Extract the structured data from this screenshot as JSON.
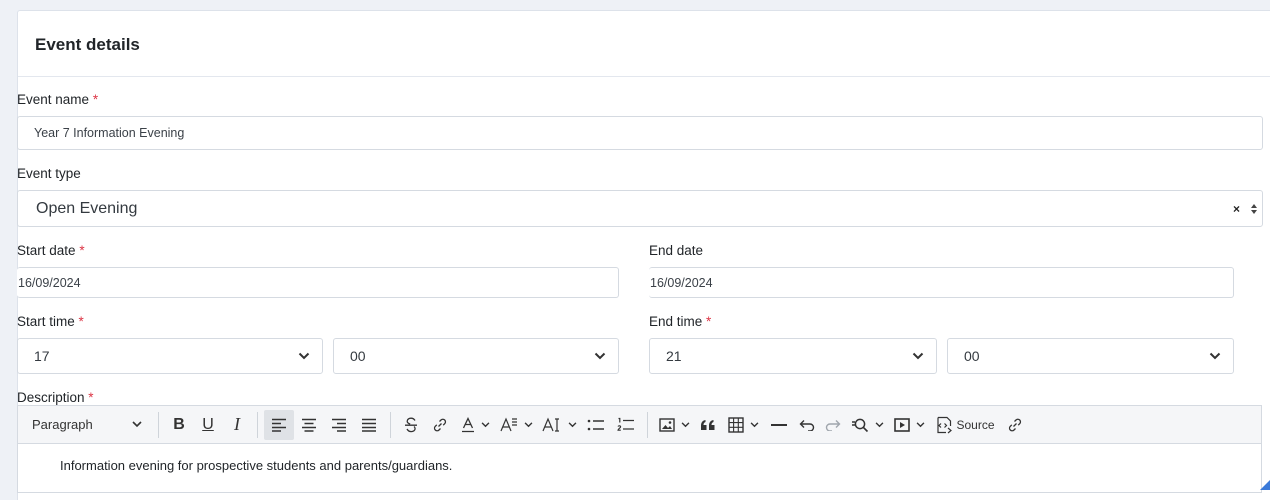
{
  "card": {
    "title": "Event details"
  },
  "event_name": {
    "label": "Event name",
    "required": "*",
    "value": "Year 7 Information Evening"
  },
  "event_type": {
    "label": "Event type",
    "value": "Open Evening",
    "clear": "×",
    "updown": "⬍"
  },
  "start_date": {
    "label": "Start date",
    "required": "*",
    "value": "16/09/2024"
  },
  "end_date": {
    "label": "End date",
    "value": "16/09/2024"
  },
  "start_time": {
    "label": "Start time",
    "required": "*",
    "hour": "17",
    "minute": "00"
  },
  "end_time": {
    "label": "End time",
    "required": "*",
    "hour": "21",
    "minute": "00"
  },
  "description": {
    "label": "Description",
    "required": "*",
    "text": "Information evening for prospective students and parents/guardians."
  },
  "toolbar": {
    "heading_select": "Paragraph",
    "bold": "B",
    "underline": "U",
    "italic": "I",
    "source_label": "Source",
    "icons": [
      "chevron-down-icon",
      "bold-icon",
      "underline-icon",
      "italic-icon",
      "align-left-icon",
      "align-center-icon",
      "align-right-icon",
      "align-justify-icon",
      "strikethrough-icon",
      "link-icon",
      "font-color-icon",
      "font-size-icon",
      "text-case-icon",
      "bulleted-list-icon",
      "numbered-list-icon",
      "image-icon",
      "blockquote-icon",
      "table-icon",
      "horizontal-line-icon",
      "undo-icon",
      "redo-icon",
      "find-replace-icon",
      "media-embed-icon",
      "source-icon",
      "unlink-icon"
    ]
  },
  "colors": {
    "required": "#dc3545",
    "accent": "#3b7ad9",
    "border": "#d5dae1",
    "toolbar_bg": "#f5f6f8"
  }
}
